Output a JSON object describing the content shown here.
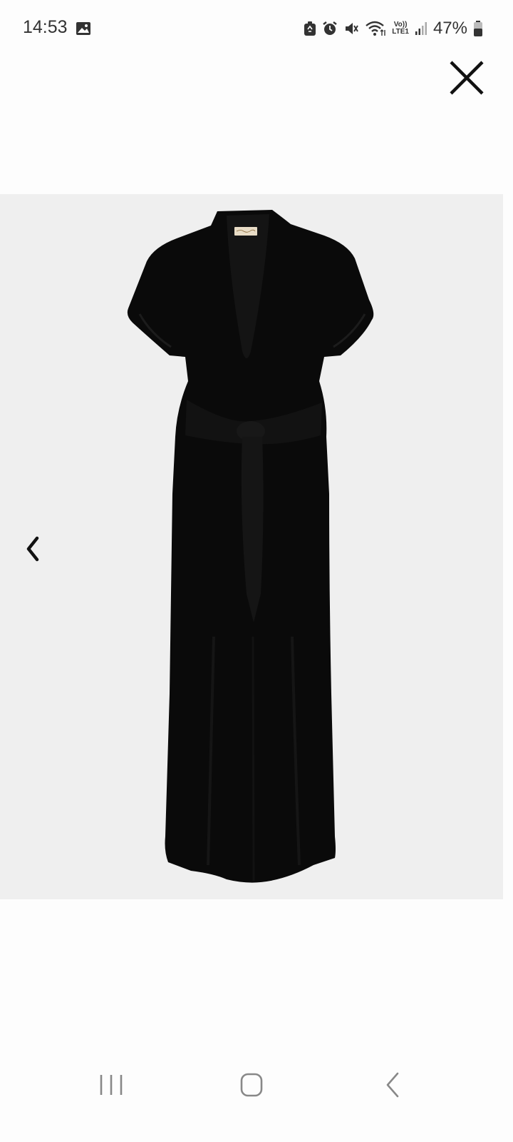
{
  "status_bar": {
    "time": "14:53",
    "battery_percent": "47%",
    "network_label_top": "Vo))",
    "network_label_bottom": "LTE1",
    "icons": [
      "gallery-icon",
      "recycle-icon",
      "alarm-icon",
      "mute-icon",
      "wifi-icon",
      "signal-icon",
      "battery-icon"
    ]
  },
  "viewer": {
    "close_icon": "close-icon",
    "prev_icon": "chevron-left-icon",
    "image_subject": "black-wrap-maxi-dress"
  },
  "nav_bar": {
    "items": [
      "recent-apps-icon",
      "home-icon",
      "back-icon"
    ]
  },
  "colors": {
    "background": "#fdfdfd",
    "image_background": "#efefef",
    "dress": "#0a0a0a",
    "icon": "#111111"
  }
}
